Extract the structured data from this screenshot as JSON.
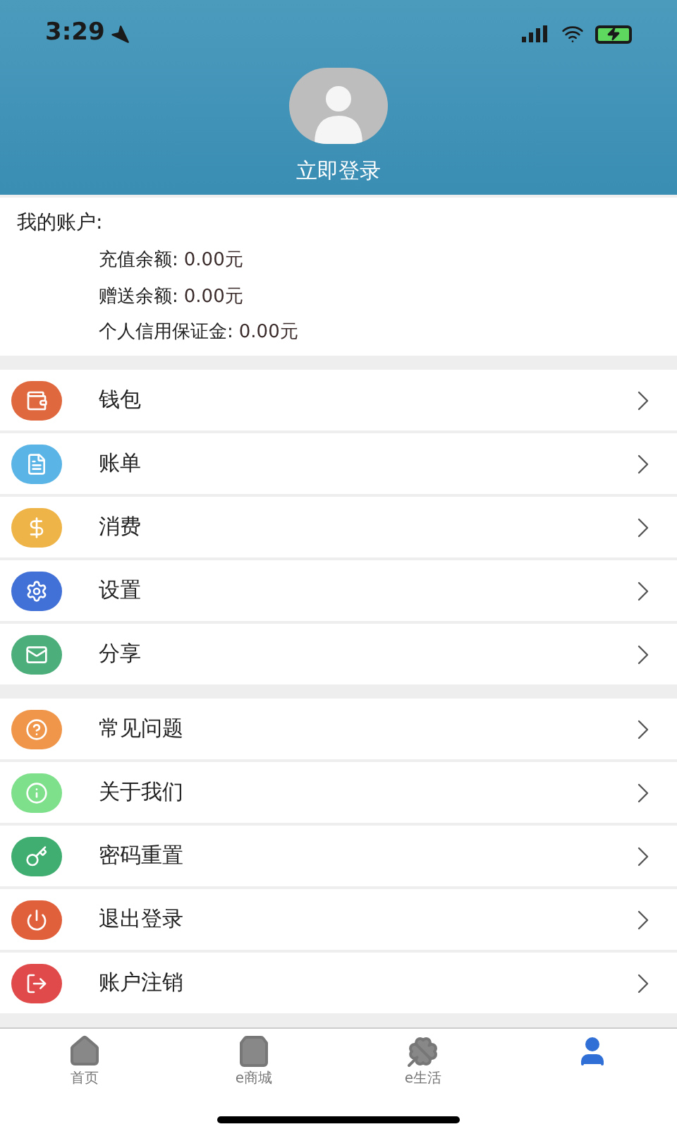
{
  "status_bar": {
    "time": "3:29"
  },
  "header": {
    "login_label": "立即登录"
  },
  "account": {
    "title": "我的账户:",
    "lines": [
      {
        "label": "充值余额:",
        "value": "0.00元"
      },
      {
        "label": "赠送余额:",
        "value": "0.00元"
      },
      {
        "label": "个人信用保证金:",
        "value": "0.00元"
      }
    ]
  },
  "menu_groups": [
    [
      {
        "label": "钱包",
        "kind": "wallet",
        "color": "#e0683e"
      },
      {
        "label": "账单",
        "kind": "bill",
        "color": "#5ab4e5"
      },
      {
        "label": "消费",
        "kind": "money",
        "color": "#efb447"
      },
      {
        "label": "设置",
        "kind": "settings",
        "color": "#4170d6"
      },
      {
        "label": "分享",
        "kind": "share",
        "color": "#4cae7a"
      }
    ],
    [
      {
        "label": "常见问题",
        "kind": "help",
        "color": "#f0964a"
      },
      {
        "label": "关于我们",
        "kind": "info",
        "color": "#7fe08c"
      },
      {
        "label": "密码重置",
        "kind": "key",
        "color": "#3fae70"
      },
      {
        "label": "退出登录",
        "kind": "power",
        "color": "#e0603c"
      },
      {
        "label": "账户注销",
        "kind": "logout",
        "color": "#e04a4a"
      }
    ]
  ],
  "tab_bar": [
    {
      "kind": "home",
      "label": "首页",
      "selected": false
    },
    {
      "kind": "shop",
      "label": "e商城",
      "selected": false
    },
    {
      "kind": "life",
      "label": "e生活",
      "selected": false
    },
    {
      "kind": "me",
      "selected": true
    }
  ]
}
